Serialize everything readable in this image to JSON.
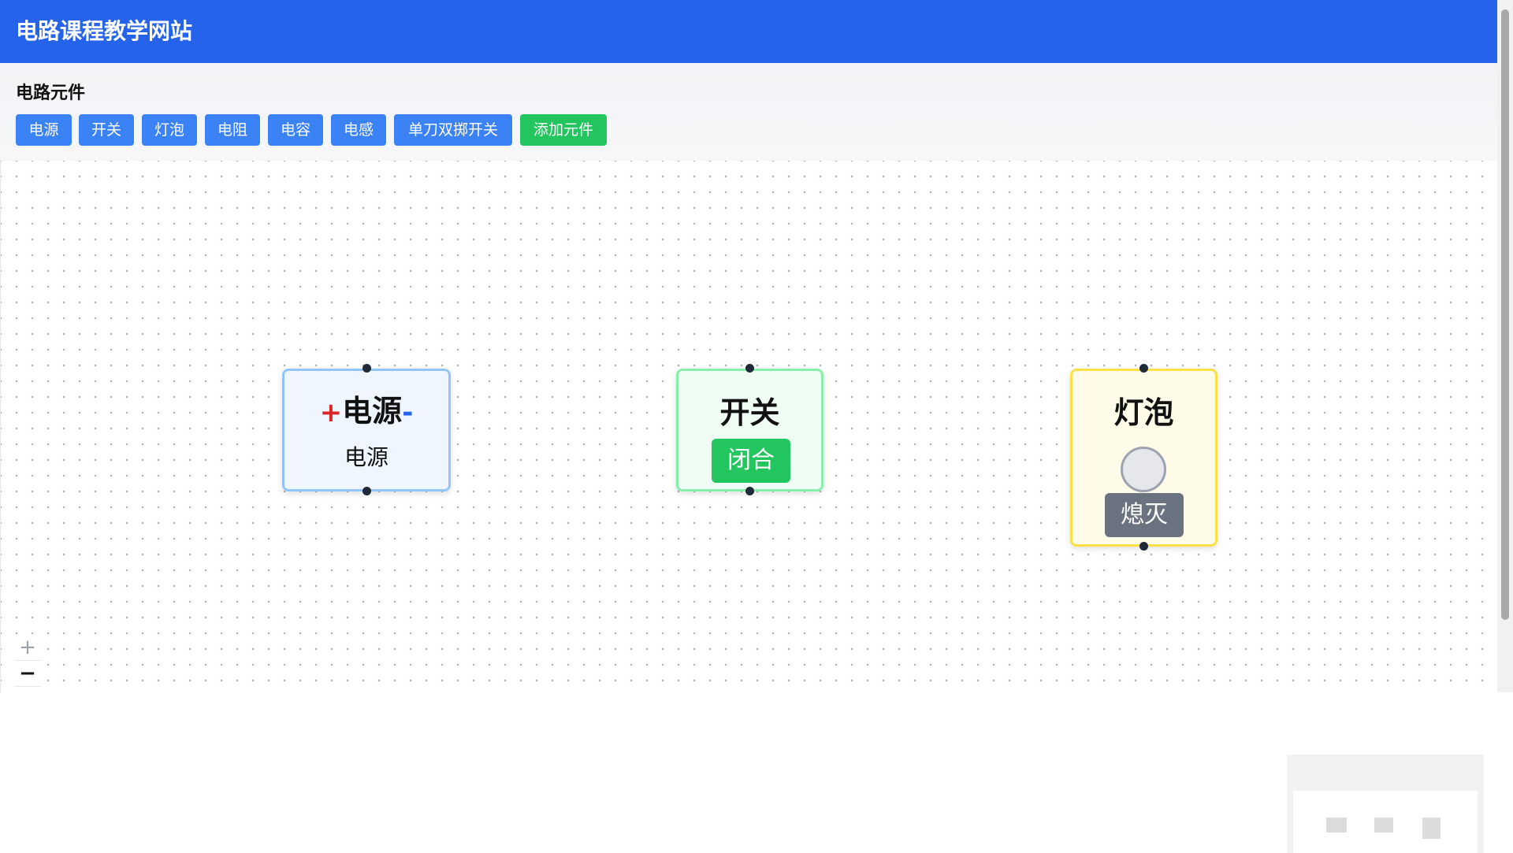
{
  "header": {
    "title": "电路课程教学网站"
  },
  "palette": {
    "heading": "电路元件",
    "buttons": [
      "电源",
      "开关",
      "灯泡",
      "电阻",
      "电容",
      "电感",
      "单刀双掷开关"
    ],
    "add_button": "添加元件"
  },
  "canvas": {
    "power": {
      "plus": "+",
      "title": "电源",
      "minus": "-",
      "label": "电源"
    },
    "switch": {
      "title": "开关",
      "state": "闭合"
    },
    "bulb": {
      "title": "灯泡",
      "state": "熄灭"
    }
  },
  "controls": {
    "zoom_in": "+",
    "zoom_out": "−"
  },
  "colors": {
    "header": "#2563eb",
    "component_button": "#3b82f6",
    "add_button": "#22c55e",
    "switch_closed": "#22c55e",
    "bulb_off": "#6b7280"
  }
}
